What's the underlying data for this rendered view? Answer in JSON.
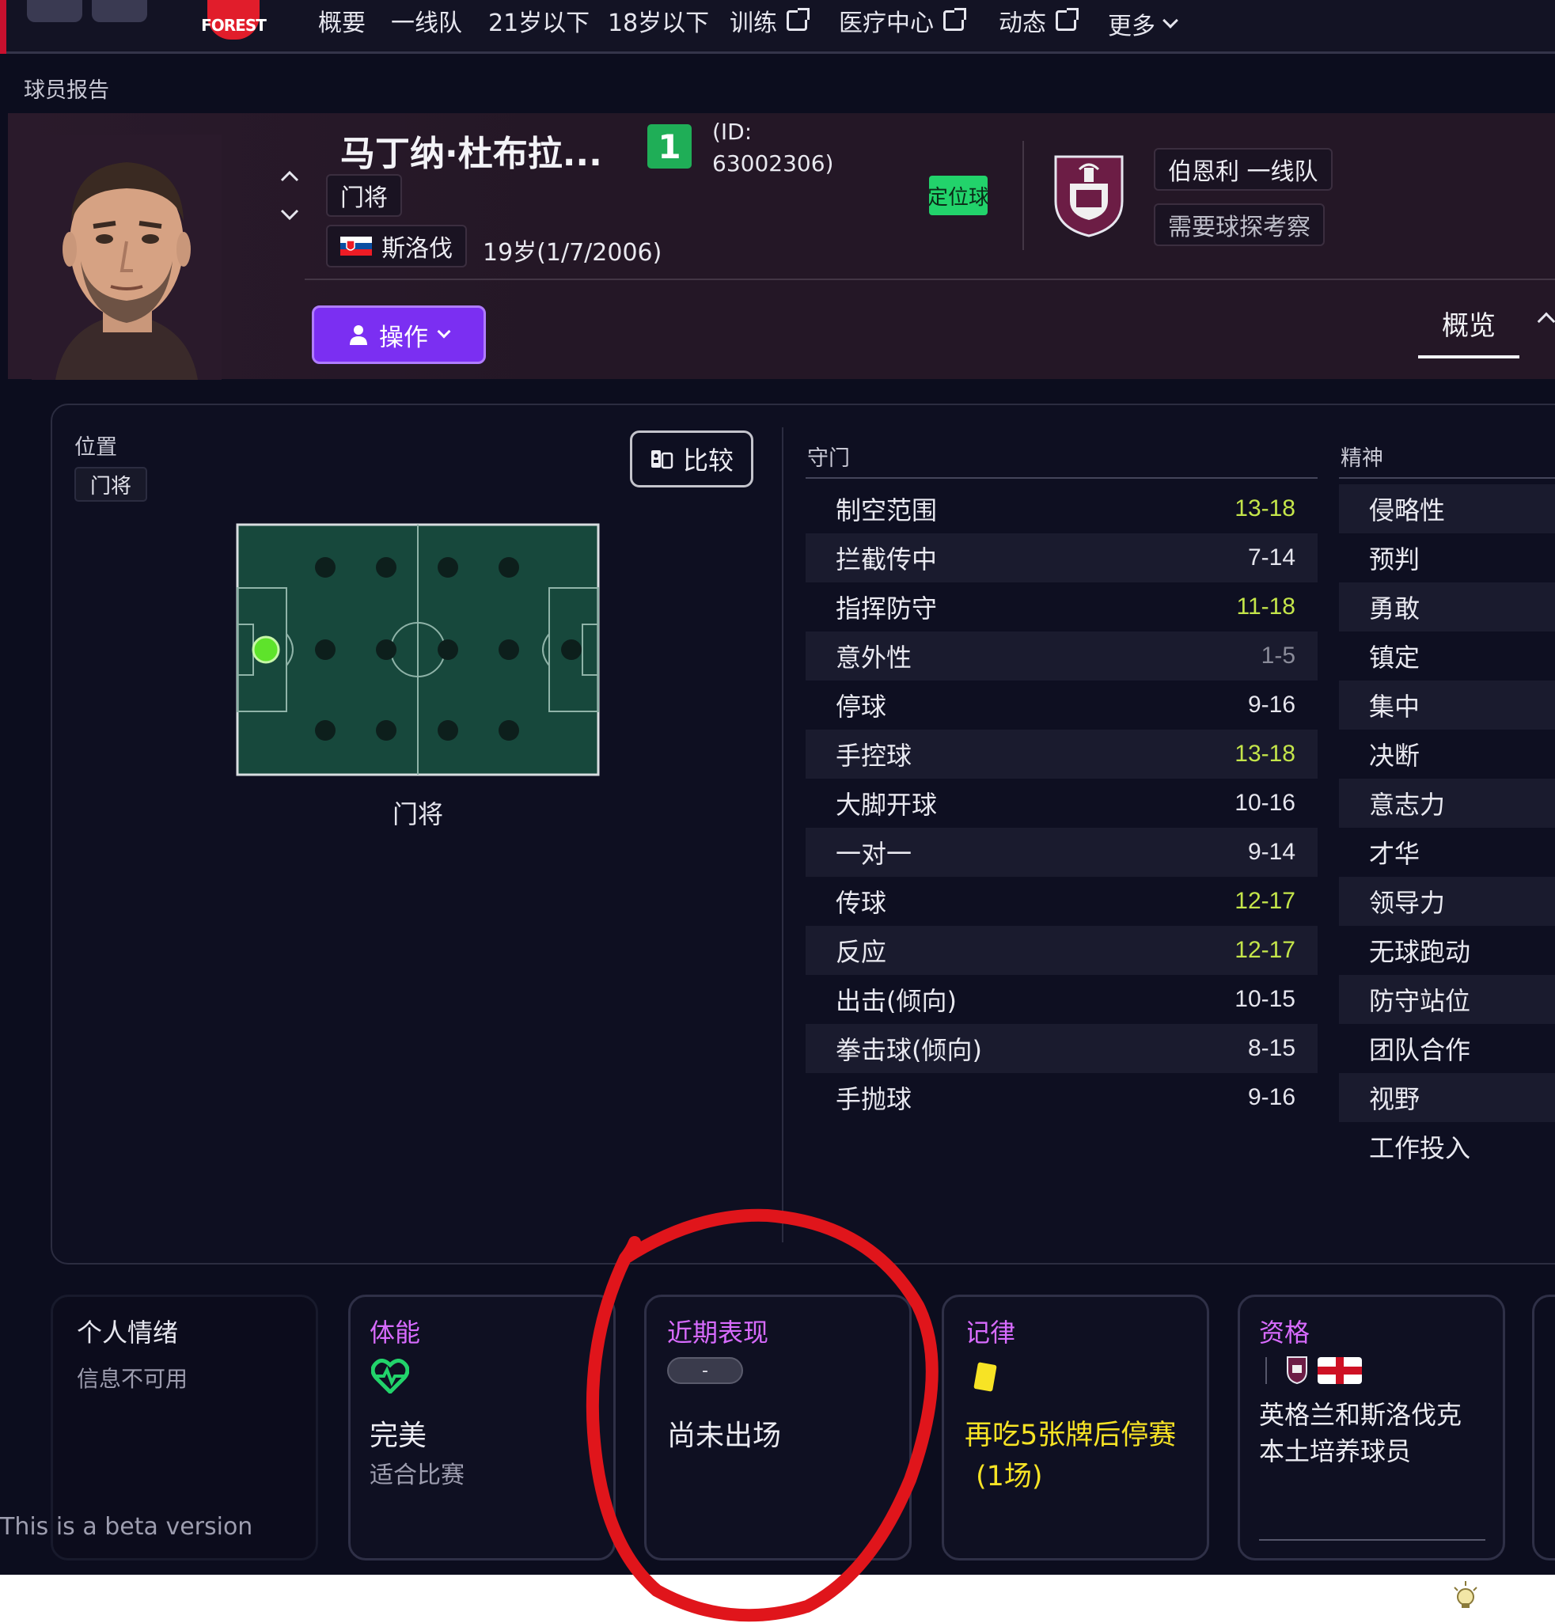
{
  "nav": {
    "logo_text": "FOREST",
    "items": [
      "概要",
      "一线队",
      "21岁以下",
      "18岁以下",
      "训练",
      "医疗中心",
      "动态",
      "更多"
    ]
  },
  "breadcrumb": "球员报告",
  "player": {
    "name": "马丁纳·杜布拉...",
    "position": "门将",
    "nationality": "斯洛伐",
    "age_dob": "19岁(1/7/2006)",
    "squad_number": "1",
    "id_label_line1": "(ID:",
    "id_label_line2": "63002306)",
    "set_piece_badge": "定位球",
    "club": "伯恩利 一线队",
    "scout_note": "需要球探考察",
    "action_button": "操作",
    "tab": "概览"
  },
  "position_panel": {
    "label": "位置",
    "chip": "门将",
    "compare_button": "比较",
    "pitch_caption": "门将"
  },
  "goalkeeping": {
    "title": "守门",
    "attributes": [
      {
        "name": "制空范围",
        "value": "13-18",
        "tone": "hi"
      },
      {
        "name": "拦截传中",
        "value": "7-14",
        "tone": "normal"
      },
      {
        "name": "指挥防守",
        "value": "11-18",
        "tone": "hi"
      },
      {
        "name": "意外性",
        "value": "1-5",
        "tone": "lo"
      },
      {
        "name": "停球",
        "value": "9-16",
        "tone": "normal"
      },
      {
        "name": "手控球",
        "value": "13-18",
        "tone": "hi"
      },
      {
        "name": "大脚开球",
        "value": "10-16",
        "tone": "normal"
      },
      {
        "name": "一对一",
        "value": "9-14",
        "tone": "normal"
      },
      {
        "name": "传球",
        "value": "12-17",
        "tone": "hi"
      },
      {
        "name": "反应",
        "value": "12-17",
        "tone": "hi"
      },
      {
        "name": "出击(倾向)",
        "value": "10-15",
        "tone": "normal"
      },
      {
        "name": "拳击球(倾向)",
        "value": "8-15",
        "tone": "normal"
      },
      {
        "name": "手抛球",
        "value": "9-16",
        "tone": "normal"
      }
    ]
  },
  "mental": {
    "title": "精神",
    "attributes": [
      "侵略性",
      "预判",
      "勇敢",
      "镇定",
      "集中",
      "决断",
      "意志力",
      "才华",
      "领导力",
      "无球跑动",
      "防守站位",
      "团队合作",
      "视野",
      "工作投入"
    ]
  },
  "cards": {
    "morale": {
      "title": "个人情绪",
      "text": "信息不可用"
    },
    "fitness": {
      "title": "体能",
      "main": "完美",
      "sub": "适合比赛"
    },
    "form": {
      "title": "近期表现",
      "pill": "-",
      "main": "尚未出场"
    },
    "discipline": {
      "title": "记律",
      "line1": "再吃5张牌后停赛",
      "line2": "(1场)"
    },
    "eligibility": {
      "title": "资格",
      "line1": "英格兰和斯洛伐克",
      "line2": "本土培养球员"
    }
  },
  "beta_notice": "This is a beta version",
  "colors": {
    "accent_purple": "#7b2ff2",
    "card_title": "#d86bff",
    "high_value": "#c4e54a",
    "squad_number_bg": "#1fae57",
    "annotation_circle": "#e0151b"
  }
}
